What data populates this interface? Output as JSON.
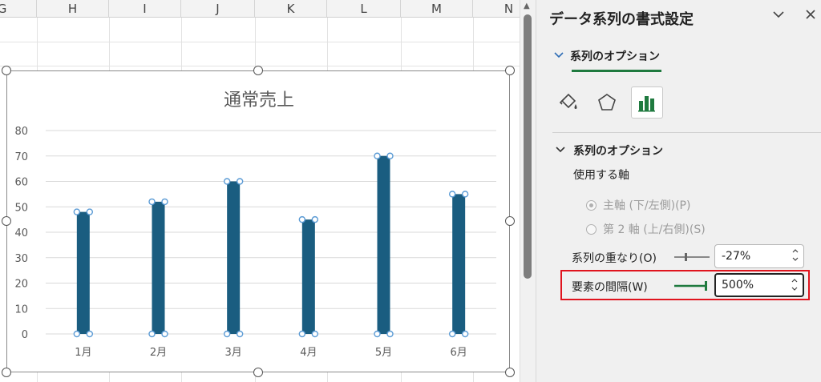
{
  "sheet": {
    "columns": [
      "G",
      "H",
      "I",
      "J",
      "K",
      "L",
      "M",
      "N"
    ]
  },
  "chart_data": {
    "type": "bar",
    "title": "通常売上",
    "categories": [
      "1月",
      "2月",
      "3月",
      "4月",
      "5月",
      "6月"
    ],
    "values": [
      48,
      52,
      60,
      45,
      70,
      55
    ],
    "ylim": [
      0,
      80
    ],
    "yticks": [
      "0",
      "10",
      "20",
      "30",
      "40",
      "50",
      "60",
      "70",
      "80"
    ],
    "grid": true,
    "bar_color": "#1a5d80",
    "selected": true
  },
  "pane": {
    "title": "データ系列の書式設定",
    "tab_label": "系列のオプション",
    "section_label": "系列のオプション",
    "axis_label": "使用する軸",
    "primary_axis_label": "主軸 (下/左側)(P)",
    "secondary_axis_label": "第 2 軸 (上/右側)(S)",
    "overlap_label": "系列の重なり(O)",
    "overlap_value": "-27%",
    "gap_label": "要素の間隔(W)",
    "gap_value": "500%",
    "accent_color": "#1f7a3f",
    "highlight_color": "#e0141e"
  }
}
